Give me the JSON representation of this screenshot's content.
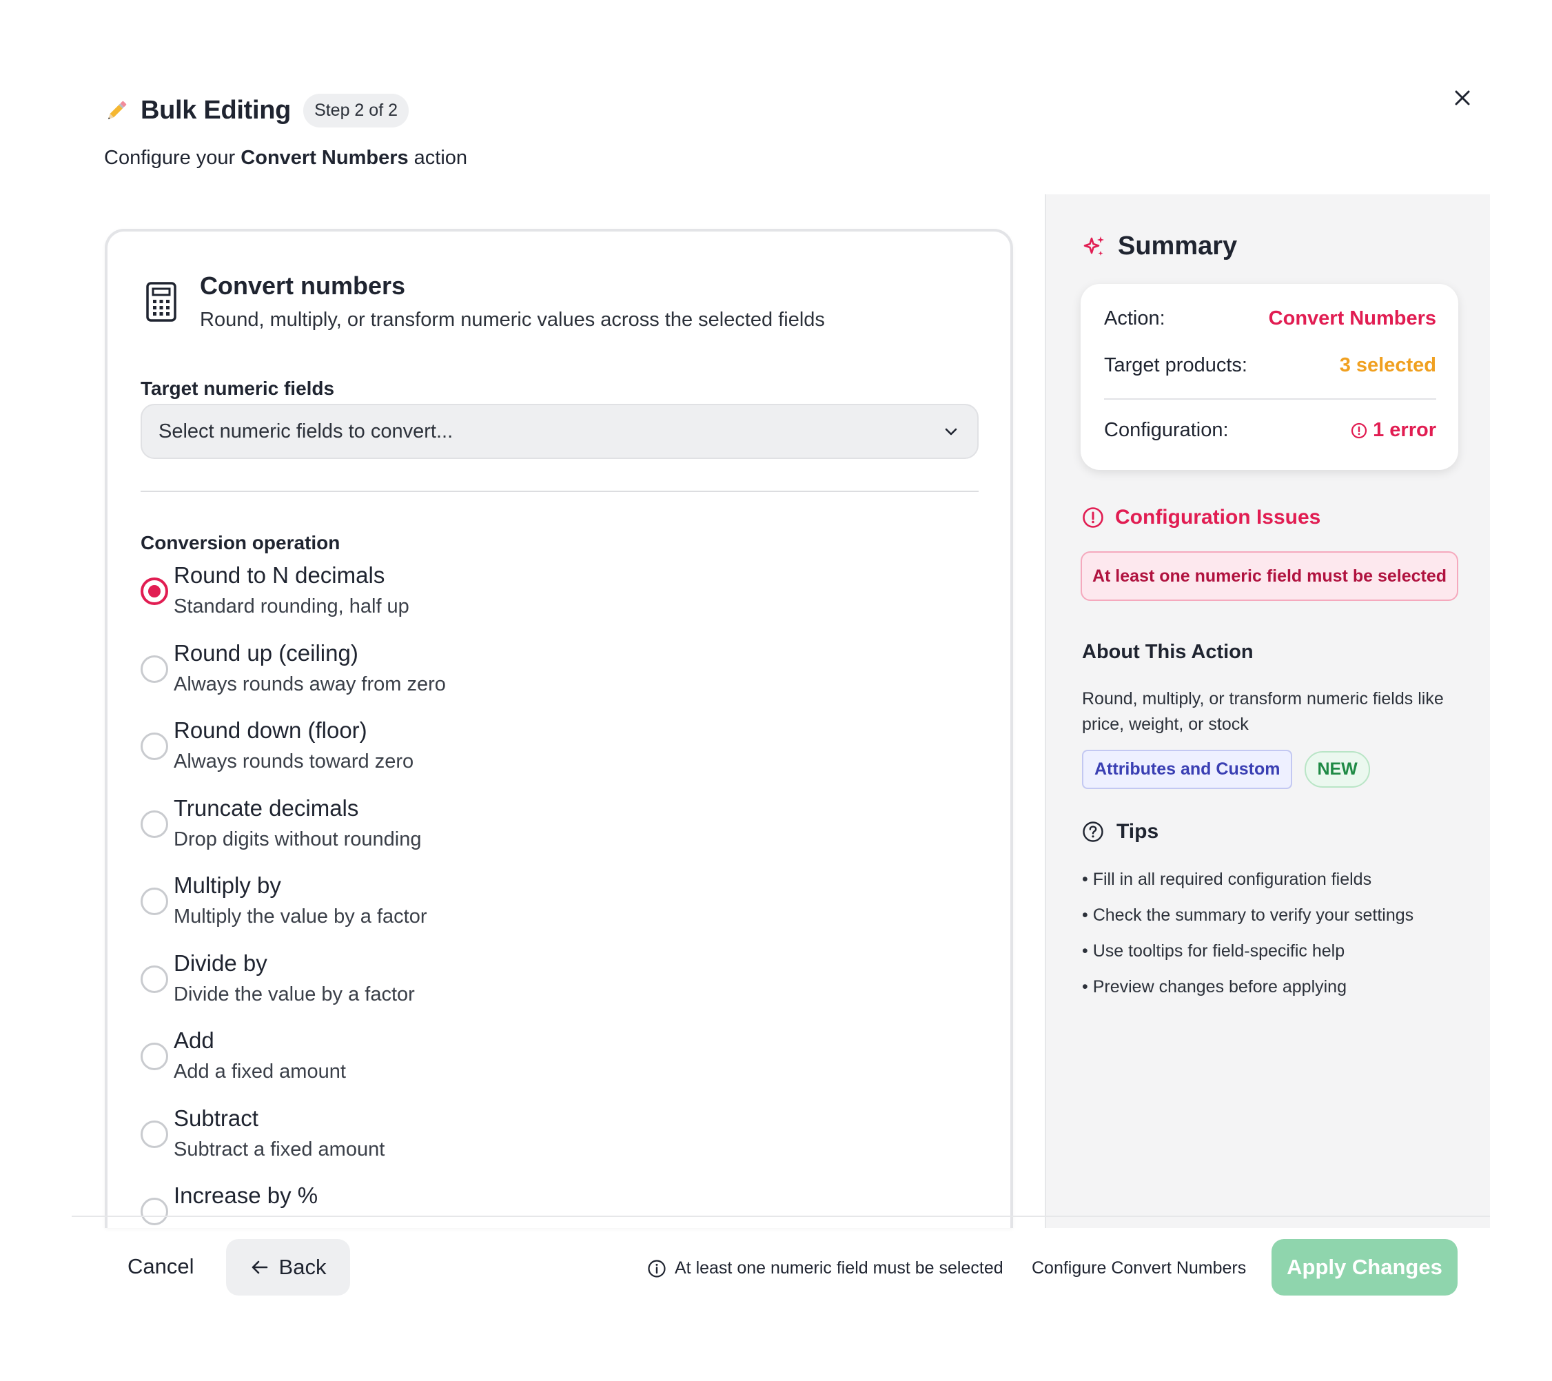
{
  "header": {
    "title": "Bulk Editing",
    "step_badge": "Step 2 of 2",
    "subtitle_prefix": "Configure your ",
    "subtitle_action": "Convert Numbers",
    "subtitle_suffix": " action",
    "close_icon": "close-icon"
  },
  "card": {
    "icon": "calculator-icon",
    "title": "Convert numbers",
    "description": "Round, multiply, or transform numeric values across the selected fields",
    "target_label": "Target numeric fields",
    "target_placeholder": "Select numeric fields to convert...",
    "operation_label": "Conversion operation",
    "operations": [
      {
        "title": "Round to N decimals",
        "desc": "Standard rounding, half up",
        "selected": true
      },
      {
        "title": "Round up (ceiling)",
        "desc": "Always rounds away from zero",
        "selected": false
      },
      {
        "title": "Round down (floor)",
        "desc": "Always rounds toward zero",
        "selected": false
      },
      {
        "title": "Truncate decimals",
        "desc": "Drop digits without rounding",
        "selected": false
      },
      {
        "title": "Multiply by",
        "desc": "Multiply the value by a factor",
        "selected": false
      },
      {
        "title": "Divide by",
        "desc": "Divide the value by a factor",
        "selected": false
      },
      {
        "title": "Add",
        "desc": "Add a fixed amount",
        "selected": false
      },
      {
        "title": "Subtract",
        "desc": "Subtract a fixed amount",
        "selected": false
      },
      {
        "title": "Increase by %",
        "desc": "",
        "selected": false
      }
    ]
  },
  "summary": {
    "title": "Summary",
    "action_key": "Action:",
    "action_value": "Convert Numbers",
    "target_key": "Target products:",
    "target_value": "3 selected",
    "config_key": "Configuration:",
    "config_value": "1 error",
    "issues_title": "Configuration Issues",
    "issue_message": "At least one numeric field must be selected",
    "about_title": "About This Action",
    "about_desc": "Round, multiply, or transform numeric fields like price, weight, or stock",
    "tag_category": "Attributes and Custom",
    "tag_new": "NEW",
    "tips_title": "Tips",
    "tips": [
      "Fill in all required configuration fields",
      "Check the summary to verify your settings",
      "Use tooltips for field-specific help",
      "Preview changes before applying"
    ]
  },
  "footer": {
    "cancel_label": "Cancel",
    "back_label": "Back",
    "message": "At least one numeric field must be selected",
    "configure_label": "Configure Convert Numbers",
    "apply_label": "Apply Changes"
  },
  "colors": {
    "accent": "#e11d52",
    "amber": "#f0a020",
    "apply_disabled": "#8fd5ad"
  }
}
